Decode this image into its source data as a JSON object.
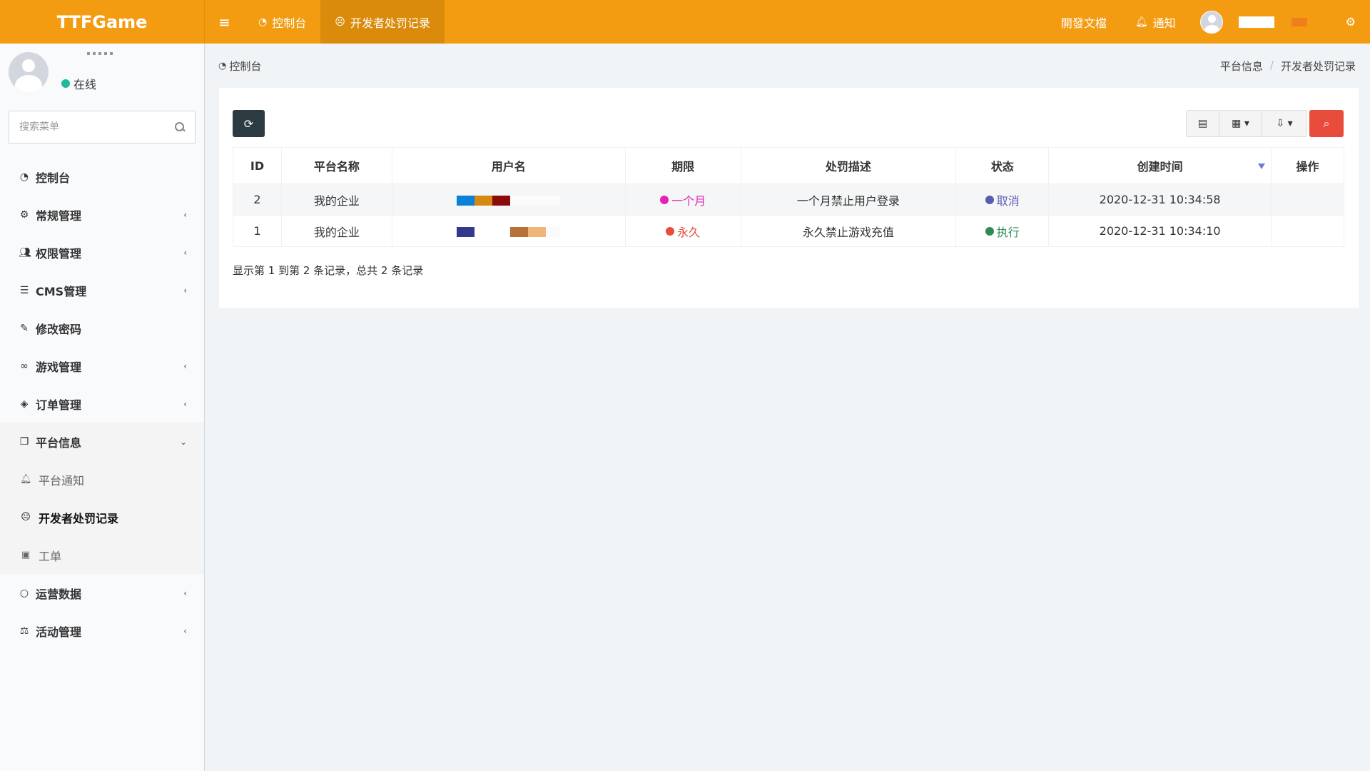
{
  "app": {
    "logo": "TTFGame"
  },
  "header": {
    "tabs": [
      {
        "label": "控制台"
      },
      {
        "label": "开发者处罚记录"
      }
    ],
    "right": {
      "docs_label": "開發文檔",
      "notify_label": "通知"
    }
  },
  "user": {
    "status": "在线"
  },
  "sidebar": {
    "search_placeholder": "搜索菜单",
    "items": [
      {
        "label": "控制台"
      },
      {
        "label": "常规管理"
      },
      {
        "label": "权限管理"
      },
      {
        "label": "CMS管理"
      },
      {
        "label": "修改密码"
      },
      {
        "label": "游戏管理"
      },
      {
        "label": "订单管理"
      },
      {
        "label": "平台信息"
      },
      {
        "label": "运营数据"
      },
      {
        "label": "活动管理"
      }
    ],
    "subitems": [
      {
        "label": "平台通知"
      },
      {
        "label": "开发者处罚记录"
      },
      {
        "label": "工单"
      }
    ]
  },
  "breadcrumb": {
    "home": "控制台",
    "parent": "平台信息",
    "current": "开发者处罚记录"
  },
  "table": {
    "columns": [
      "ID",
      "平台名称",
      "用户名",
      "期限",
      "处罚描述",
      "状态",
      "创建时间",
      "操作"
    ],
    "rows": [
      {
        "id": "2",
        "platform": "我的企业",
        "term": "一个月",
        "term_color": "#e622b3",
        "desc": "一个月禁止用户登录",
        "status": "取消",
        "status_color": "#5a5ab0",
        "created": "2020-12-31 10:34:58"
      },
      {
        "id": "1",
        "platform": "我的企业",
        "term": "永久",
        "term_color": "#e74c3c",
        "desc": "永久禁止游戏充值",
        "status": "执行",
        "status_color": "#2e8b57",
        "created": "2020-12-31 10:34:10"
      }
    ],
    "summary": "显示第 1 到第 2 条记录，总共 2 条记录"
  }
}
